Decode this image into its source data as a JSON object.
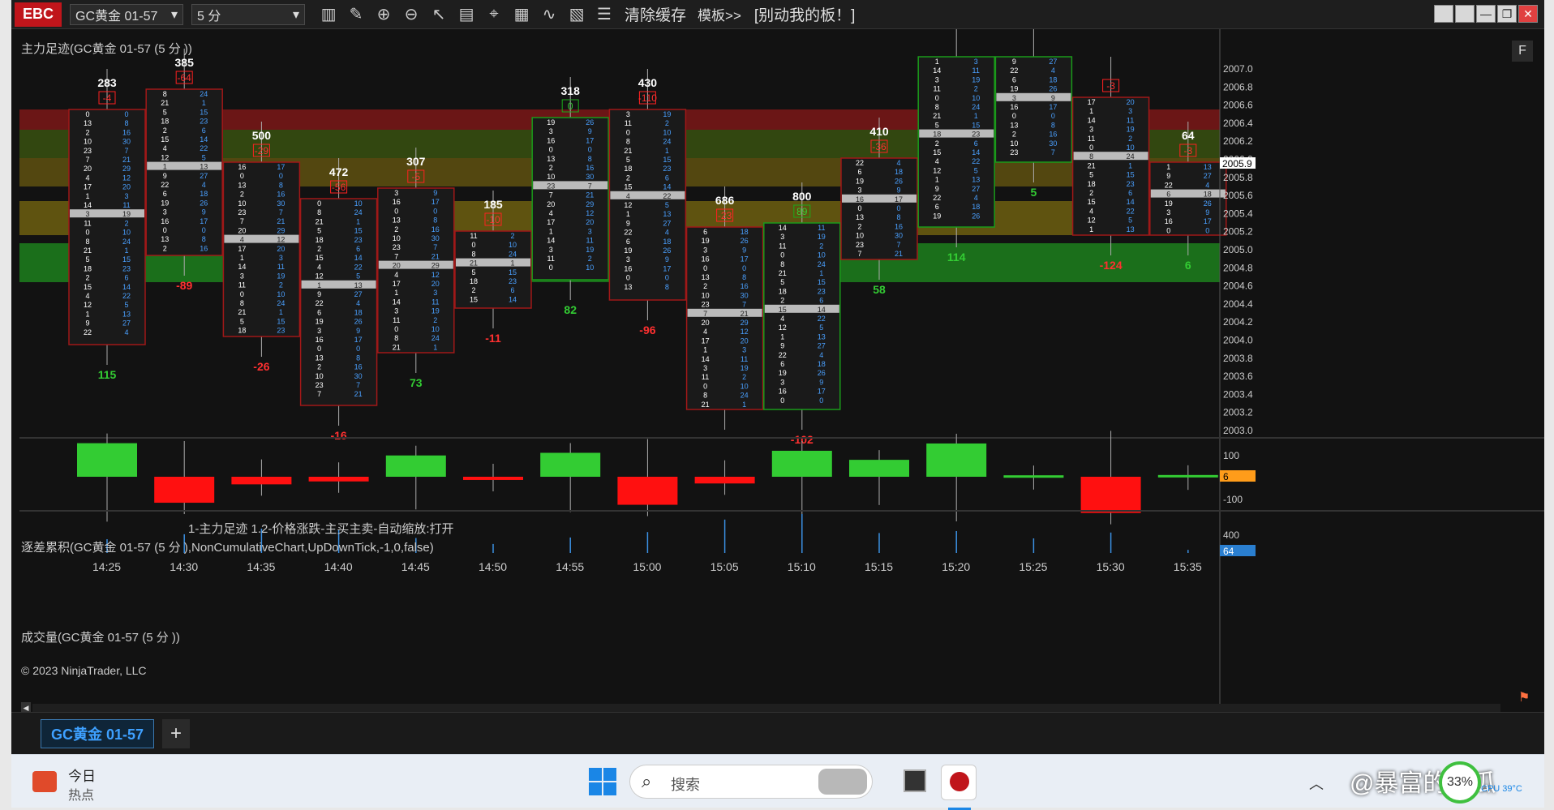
{
  "toolbar": {
    "logo": "EBC",
    "instrument": "GC黄金 01-57",
    "period": "5 分",
    "clear_label": "清除缓存",
    "template_label": "模板>>",
    "caption": "[别动我的板！]",
    "icons": [
      "bar-chart-icon",
      "pencil-icon",
      "zoom-in-icon",
      "zoom-out-icon",
      "cursor-icon",
      "data-box-icon",
      "crosshair-icon",
      "indicator-icon",
      "strategy-icon",
      "properties-icon",
      "list-icon"
    ]
  },
  "panels": {
    "main_title": "主力足迹(GC黄金 01-57 (5 分 ))",
    "delta_title": "逐差累积(GC黄金 01-57 (5 分 ),NonCumulativeChart,UpDownTick,-1,0,false)",
    "volume_title": "成交量(GC黄金 01-57 (5 分 ))",
    "status_line": "1-主力足迹 1.2-价格涨跌-主买主卖-自动缩放:打开",
    "copyright": "© 2023 NinjaTrader, LLC",
    "f_button": "F"
  },
  "chart_data": [
    {
      "type": "footprint",
      "x": [
        "14:25",
        "14:30",
        "14:35",
        "14:40",
        "14:45",
        "14:50",
        "14:55",
        "15:00",
        "15:05",
        "15:10",
        "15:15",
        "15:20",
        "15:25",
        "15:30",
        "15:35"
      ],
      "y_ticks": [
        "2007.0",
        "2006.8",
        "2006.6",
        "2006.4",
        "2006.2",
        "2006.0",
        "2005.8",
        "2005.6",
        "2005.4",
        "2005.2",
        "2005.0",
        "2004.8",
        "2004.6",
        "2004.4",
        "2004.2",
        "2004.0",
        "2003.8",
        "2003.6",
        "2003.4",
        "2003.2",
        "2003.0"
      ],
      "current_price": "2005.9",
      "bar_volume_top": [
        "283",
        "385",
        "500",
        "472",
        "307",
        "185",
        "318",
        "430",
        "686",
        "800",
        "410",
        "",
        "",
        "",
        "64"
      ],
      "bar_delta_top": [
        "-4",
        "-64",
        "-29",
        "-56",
        "-5",
        "-10",
        "0",
        "-110",
        "-23",
        "89",
        "-36",
        "",
        "",
        "-3",
        "-3"
      ],
      "bar_bottom_value": [
        "115",
        "-89",
        "-26",
        "-16",
        "73",
        "-11",
        "82",
        "-96",
        "",
        "-102",
        "58",
        "114",
        "5",
        "-124",
        "6"
      ]
    },
    {
      "type": "bar",
      "title": "逐差累积",
      "x": [
        "14:25",
        "14:30",
        "14:35",
        "14:40",
        "14:45",
        "14:50",
        "14:55",
        "15:00",
        "15:05",
        "15:10",
        "15:15",
        "15:20",
        "15:25",
        "15:30",
        "15:35"
      ],
      "values": [
        115,
        -89,
        -26,
        -16,
        73,
        -11,
        82,
        -96,
        -23,
        89,
        58,
        114,
        5,
        -124,
        6
      ],
      "y_ticks": [
        "100",
        "-100"
      ],
      "last_value": "6"
    },
    {
      "type": "bar",
      "title": "成交量",
      "x": [
        "14:25",
        "14:30",
        "14:35",
        "14:40",
        "14:45",
        "14:50",
        "14:55",
        "15:00",
        "15:05",
        "15:10",
        "15:15",
        "15:20",
        "15:25",
        "15:30",
        "15:35"
      ],
      "values": [
        283,
        385,
        500,
        472,
        307,
        185,
        318,
        430,
        686,
        800,
        410,
        450,
        300,
        420,
        64
      ],
      "y_ticks": [
        "400"
      ],
      "last_value": "64"
    }
  ],
  "time_axis": [
    "14:25",
    "14:30",
    "14:35",
    "14:40",
    "14:45",
    "14:50",
    "14:55",
    "15:00",
    "15:05",
    "15:10",
    "15:15",
    "15:20",
    "15:25",
    "15:30",
    "15:35"
  ],
  "footer": {
    "tab_label": "GC黄金 01-57",
    "add_label": "+"
  },
  "taskbar": {
    "news_title": "今日",
    "news_sub": "热点",
    "search_placeholder": "搜索",
    "watermark": "@暴富的西瓜",
    "cpu_percent": "33%",
    "cpu_temp": "CPU 39°C"
  },
  "colors": {
    "up": "#33cc33",
    "down": "#ff0000",
    "bright_green": "#00ff00",
    "buy_text": "#4aa0ff",
    "sell_text": "#ffffff",
    "accent": "#3ea0ff",
    "logo_red": "#c0151b"
  }
}
